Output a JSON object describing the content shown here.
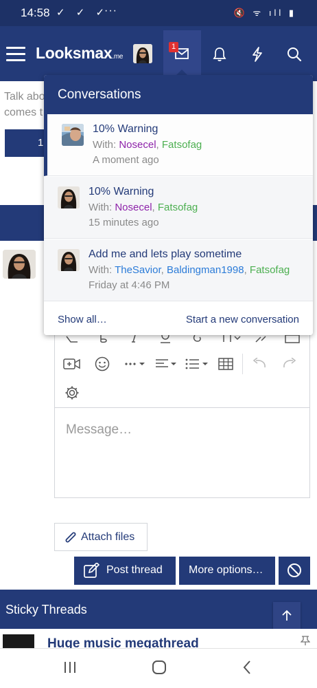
{
  "status_bar": {
    "time": "14:58",
    "checks": "✓ ✓ ✓",
    "dots": "···",
    "sys_icons": "🔇 ᯤ ıll ▮"
  },
  "header": {
    "logo_main": "Looksmax",
    "logo_suffix": ".me",
    "inbox_badge": "1"
  },
  "page": {
    "intro_line1": "Talk abo",
    "intro_line2": "comes t",
    "partial_button": "1",
    "editor_placeholder": "Message…",
    "attach_label": "Attach files",
    "post_label": "Post thread",
    "more_label": "More options…",
    "sticky_title": "Sticky Threads",
    "thread_title": "Huge music megathread"
  },
  "popup": {
    "title": "Conversations",
    "with_prefix": "With:",
    "conversations": [
      {
        "title": "10% Warning",
        "participants": [
          "Nosecel",
          "Fatsofag"
        ],
        "when": "A moment ago"
      },
      {
        "title": "10% Warning",
        "participants": [
          "Nosecel",
          "Fatsofag"
        ],
        "when": "15 minutes ago"
      },
      {
        "title": "Add me and lets play sometime",
        "participants": [
          "TheSavior",
          "Baldingman1998",
          "Fatsofag"
        ],
        "when": "Friday at 4:46 PM"
      }
    ],
    "show_all": "Show all…",
    "start_new": "Start a new conversation"
  },
  "colors": {
    "brand": "#233a78",
    "user_purple": "#8e24aa",
    "user_green": "#4caf50",
    "user_blue": "#2b7bd8"
  }
}
